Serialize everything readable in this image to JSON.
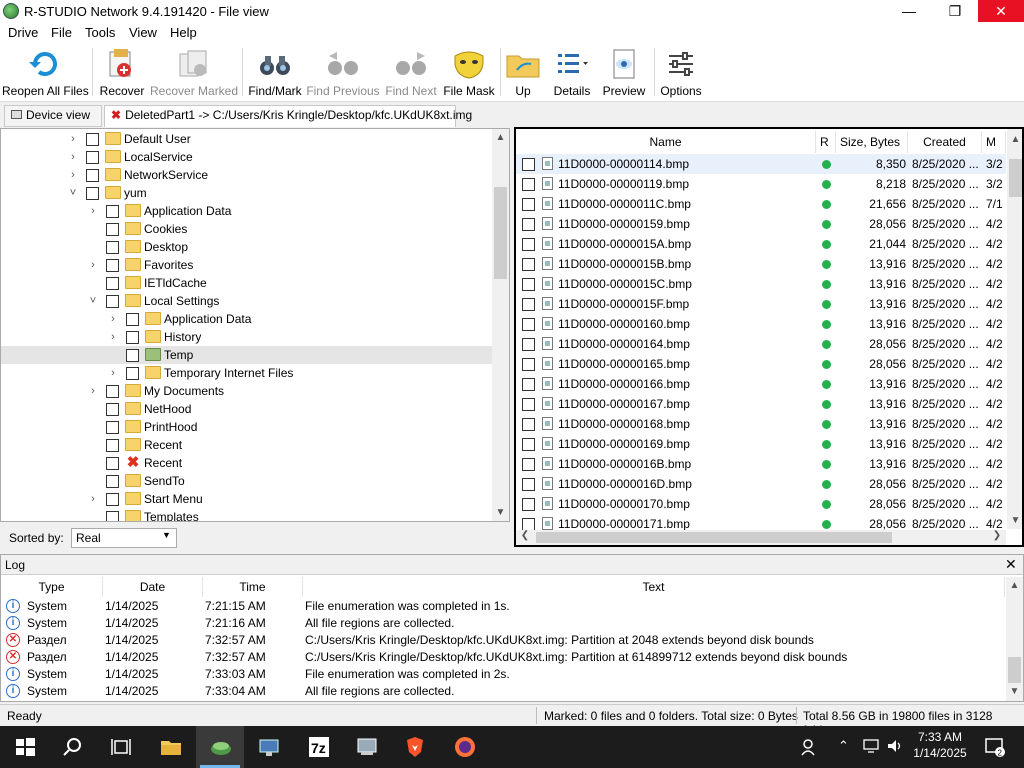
{
  "window": {
    "title": "R-STUDIO Network 9.4.191420 - File view"
  },
  "menu": [
    "Drive",
    "File",
    "Tools",
    "View",
    "Help"
  ],
  "toolbar": [
    {
      "label": "Reopen All Files",
      "icon": "reopen-icon",
      "enabled": true
    },
    {
      "label": "Recover",
      "icon": "recover-icon",
      "enabled": true
    },
    {
      "label": "Recover Marked",
      "icon": "recover-marked-icon",
      "enabled": false
    },
    {
      "label": "Find/Mark",
      "icon": "binoculars-icon",
      "enabled": true
    },
    {
      "label": "Find Previous",
      "icon": "binoculars-prev-icon",
      "enabled": false
    },
    {
      "label": "Find Next",
      "icon": "binoculars-next-icon",
      "enabled": false
    },
    {
      "label": "File Mask",
      "icon": "mask-icon",
      "enabled": true
    },
    {
      "label": "Up",
      "icon": "folder-up-icon",
      "enabled": true
    },
    {
      "label": "Details",
      "icon": "details-icon",
      "enabled": true
    },
    {
      "label": "Preview",
      "icon": "preview-icon",
      "enabled": true
    },
    {
      "label": "Options",
      "icon": "options-icon",
      "enabled": true
    }
  ],
  "tabs": [
    {
      "label": "Device view",
      "icon": "device-icon"
    },
    {
      "label": "DeletedPart1 -> C:/Users/Kris Kringle/Desktop/kfc.UKdUK8xt.img",
      "icon": "close-x-icon"
    }
  ],
  "tree": [
    {
      "label": "Default User",
      "chevron": ">",
      "level": 0
    },
    {
      "label": "LocalService",
      "chevron": ">",
      "level": 0
    },
    {
      "label": "NetworkService",
      "chevron": ">",
      "level": 0
    },
    {
      "label": "yum",
      "chevron": "v",
      "level": 0
    },
    {
      "label": "Application Data",
      "chevron": ">",
      "level": 1
    },
    {
      "label": "Cookies",
      "chevron": "",
      "level": 1
    },
    {
      "label": "Desktop",
      "chevron": "",
      "level": 1
    },
    {
      "label": "Favorites",
      "chevron": ">",
      "level": 1
    },
    {
      "label": "IETldCache",
      "chevron": "",
      "level": 1
    },
    {
      "label": "Local Settings",
      "chevron": "v",
      "level": 1
    },
    {
      "label": "Application Data",
      "chevron": ">",
      "level": 2
    },
    {
      "label": "History",
      "chevron": ">",
      "level": 2
    },
    {
      "label": "Temp",
      "chevron": "",
      "level": 2,
      "selected": true,
      "icon": "green"
    },
    {
      "label": "Temporary Internet Files",
      "chevron": ">",
      "level": 2
    },
    {
      "label": "My Documents",
      "chevron": ">",
      "level": 1
    },
    {
      "label": "NetHood",
      "chevron": "",
      "level": 1
    },
    {
      "label": "PrintHood",
      "chevron": "",
      "level": 1
    },
    {
      "label": "Recent",
      "chevron": "",
      "level": 1
    },
    {
      "label": "Recent",
      "chevron": "",
      "level": 1,
      "icon": "deleted"
    },
    {
      "label": "SendTo",
      "chevron": "",
      "level": 1
    },
    {
      "label": "Start Menu",
      "chevron": ">",
      "level": 1
    },
    {
      "label": "Templates",
      "chevron": "",
      "level": 1
    }
  ],
  "sorted": {
    "label": "Sorted by:",
    "value": "Real"
  },
  "file_list": {
    "columns": [
      "Name",
      "R",
      "Size, Bytes",
      "Created",
      "M"
    ],
    "rows": [
      {
        "name": "11D0000-00000114.bmp",
        "size": "8,350",
        "created": "8/25/2020 ...",
        "m": "3/2"
      },
      {
        "name": "11D0000-00000119.bmp",
        "size": "8,218",
        "created": "8/25/2020 ...",
        "m": "3/2"
      },
      {
        "name": "11D0000-0000011C.bmp",
        "size": "21,656",
        "created": "8/25/2020 ...",
        "m": "7/1"
      },
      {
        "name": "11D0000-00000159.bmp",
        "size": "28,056",
        "created": "8/25/2020 ...",
        "m": "4/2"
      },
      {
        "name": "11D0000-0000015A.bmp",
        "size": "21,044",
        "created": "8/25/2020 ...",
        "m": "4/2"
      },
      {
        "name": "11D0000-0000015B.bmp",
        "size": "13,916",
        "created": "8/25/2020 ...",
        "m": "4/2"
      },
      {
        "name": "11D0000-0000015C.bmp",
        "size": "13,916",
        "created": "8/25/2020 ...",
        "m": "4/2"
      },
      {
        "name": "11D0000-0000015F.bmp",
        "size": "13,916",
        "created": "8/25/2020 ...",
        "m": "4/2"
      },
      {
        "name": "11D0000-00000160.bmp",
        "size": "13,916",
        "created": "8/25/2020 ...",
        "m": "4/2"
      },
      {
        "name": "11D0000-00000164.bmp",
        "size": "28,056",
        "created": "8/25/2020 ...",
        "m": "4/2"
      },
      {
        "name": "11D0000-00000165.bmp",
        "size": "28,056",
        "created": "8/25/2020 ...",
        "m": "4/2"
      },
      {
        "name": "11D0000-00000166.bmp",
        "size": "13,916",
        "created": "8/25/2020 ...",
        "m": "4/2"
      },
      {
        "name": "11D0000-00000167.bmp",
        "size": "13,916",
        "created": "8/25/2020 ...",
        "m": "4/2"
      },
      {
        "name": "11D0000-00000168.bmp",
        "size": "13,916",
        "created": "8/25/2020 ...",
        "m": "4/2"
      },
      {
        "name": "11D0000-00000169.bmp",
        "size": "13,916",
        "created": "8/25/2020 ...",
        "m": "4/2"
      },
      {
        "name": "11D0000-0000016B.bmp",
        "size": "13,916",
        "created": "8/25/2020 ...",
        "m": "4/2"
      },
      {
        "name": "11D0000-0000016D.bmp",
        "size": "28,056",
        "created": "8/25/2020 ...",
        "m": "4/2"
      },
      {
        "name": "11D0000-00000170.bmp",
        "size": "28,056",
        "created": "8/25/2020 ...",
        "m": "4/2"
      },
      {
        "name": "11D0000-00000171.bmp",
        "size": "28,056",
        "created": "8/25/2020 ...",
        "m": "4/2"
      }
    ]
  },
  "log": {
    "title": "Log",
    "columns": [
      "Type",
      "Date",
      "Time",
      "Text"
    ],
    "rows": [
      {
        "kind": "info",
        "type": "System",
        "date": "1/14/2025",
        "time": "7:21:15 AM",
        "text": "File enumeration was completed in 1s."
      },
      {
        "kind": "info",
        "type": "System",
        "date": "1/14/2025",
        "time": "7:21:16 AM",
        "text": "All file regions are collected."
      },
      {
        "kind": "error",
        "type": "Раздел",
        "date": "1/14/2025",
        "time": "7:32:57 AM",
        "text": "C:/Users/Kris Kringle/Desktop/kfc.UKdUK8xt.img: Partition at 2048 extends beyond disk bounds"
      },
      {
        "kind": "error",
        "type": "Раздел",
        "date": "1/14/2025",
        "time": "7:32:57 AM",
        "text": "C:/Users/Kris Kringle/Desktop/kfc.UKdUK8xt.img: Partition at 614899712 extends beyond disk bounds"
      },
      {
        "kind": "info",
        "type": "System",
        "date": "1/14/2025",
        "time": "7:33:03 AM",
        "text": "File enumeration was completed in 2s."
      },
      {
        "kind": "info",
        "type": "System",
        "date": "1/14/2025",
        "time": "7:33:04 AM",
        "text": "All file regions are collected."
      }
    ]
  },
  "status": {
    "left": "Ready",
    "marked": "Marked: 0 files and 0 folders. Total size: 0 Bytes",
    "total": "Total 8.56 GB in 19800 files in 3128 folders"
  },
  "taskbar": {
    "apps": [
      "start-icon",
      "search-icon",
      "task-view-icon",
      "file-explorer-icon",
      "r-studio-icon",
      "network-icon",
      "7zip-icon",
      "disk-tool-icon",
      "brave-icon",
      "firefox-icon"
    ],
    "active_index": 4,
    "time": "7:33 AM",
    "date": "1/14/2025"
  },
  "colors": {
    "accent": "#0078d7",
    "recoverable": "#22b14c",
    "close": "#e81123"
  }
}
